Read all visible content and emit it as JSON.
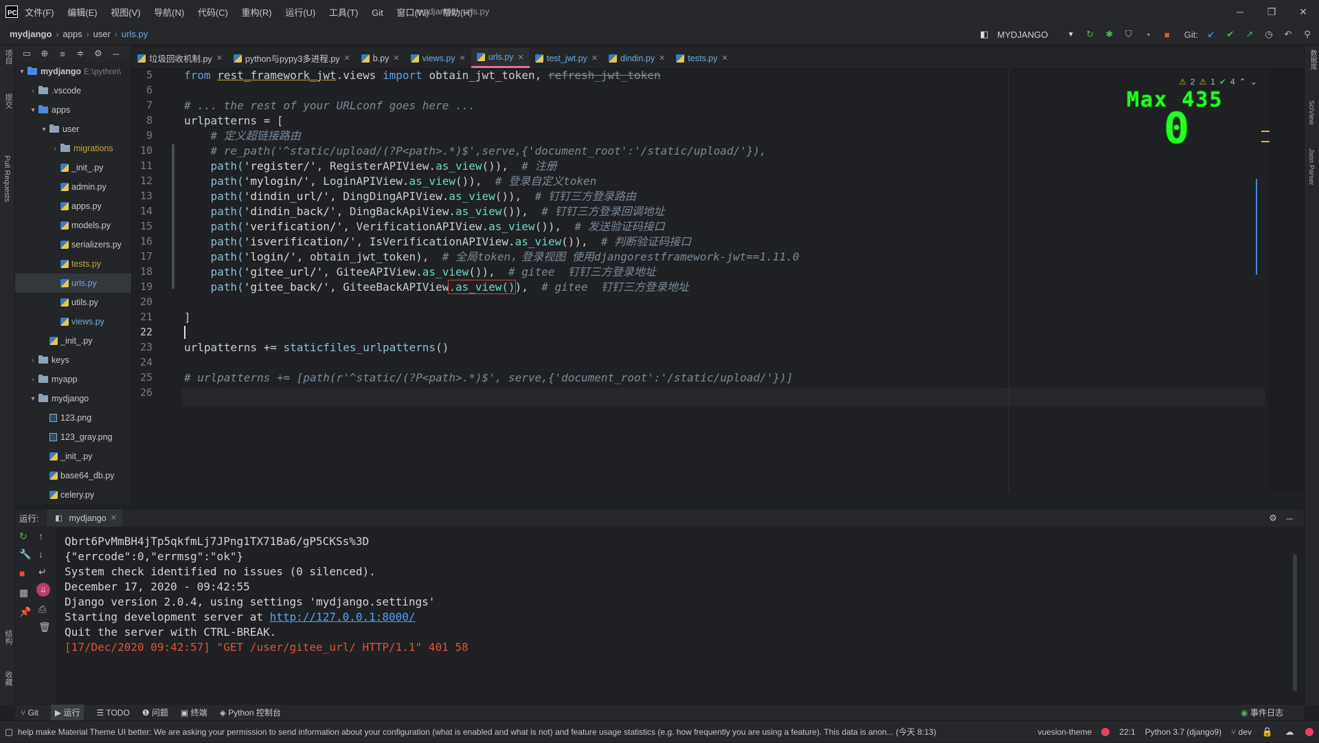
{
  "window": {
    "title": "mydjango - urls.py",
    "menu": [
      "文件(F)",
      "编辑(E)",
      "视图(V)",
      "导航(N)",
      "代码(C)",
      "重构(R)",
      "运行(U)",
      "工具(T)",
      "Git",
      "窗口(W)",
      "帮助(H)"
    ]
  },
  "breadcrumb": {
    "items": [
      "mydjango",
      "apps",
      "user",
      "urls.py"
    ],
    "run_config": "MYDJANGO",
    "git_label": "Git:"
  },
  "project_tree": [
    {
      "label": "mydjango",
      "extra": "E:\\python\\",
      "type": "folder-blue",
      "level": 0,
      "arrow": "▾",
      "bold": true
    },
    {
      "label": ".vscode",
      "type": "folder",
      "level": 1,
      "arrow": "›"
    },
    {
      "label": "apps",
      "type": "folder-blue",
      "level": 1,
      "arrow": "▾"
    },
    {
      "label": "user",
      "type": "folder",
      "level": 2,
      "arrow": "▾"
    },
    {
      "label": "migrations",
      "type": "folder",
      "level": 3,
      "arrow": "›",
      "cls": "mig"
    },
    {
      "label": "_init_.py",
      "type": "py",
      "level": 3
    },
    {
      "label": "admin.py",
      "type": "py",
      "level": 3
    },
    {
      "label": "apps.py",
      "type": "py",
      "level": 3
    },
    {
      "label": "models.py",
      "type": "py",
      "level": 3
    },
    {
      "label": "serializers.py",
      "type": "py",
      "level": 3
    },
    {
      "label": "tests.py",
      "type": "py",
      "level": 3,
      "cls": "yfile"
    },
    {
      "label": "urls.py",
      "type": "py",
      "level": 3,
      "cls": "vfile",
      "selected": true
    },
    {
      "label": "utils.py",
      "type": "py",
      "level": 3
    },
    {
      "label": "views.py",
      "type": "py",
      "level": 3,
      "cls": "vfile"
    },
    {
      "label": "_init_.py",
      "type": "py",
      "level": 2
    },
    {
      "label": "keys",
      "type": "folder",
      "level": 1,
      "arrow": "›"
    },
    {
      "label": "myapp",
      "type": "folder",
      "level": 1,
      "arrow": "›"
    },
    {
      "label": "mydjango",
      "type": "folder",
      "level": 1,
      "arrow": "▾"
    },
    {
      "label": "123.png",
      "type": "img",
      "level": 2
    },
    {
      "label": "123_gray.png",
      "type": "img",
      "level": 2
    },
    {
      "label": "_init_.py",
      "type": "py",
      "level": 2
    },
    {
      "label": "base64_db.py",
      "type": "py",
      "level": 2
    },
    {
      "label": "celery.py",
      "type": "py",
      "level": 2
    }
  ],
  "tabs": [
    {
      "label": "垃圾回收机制.py"
    },
    {
      "label": "python与pypy3多进程.py"
    },
    {
      "label": "b.py"
    },
    {
      "label": "views.py",
      "blue": true
    },
    {
      "label": "urls.py",
      "active": true
    },
    {
      "label": "test_jwt.py",
      "blue": true
    },
    {
      "label": "dindin.py",
      "blue": true
    },
    {
      "label": "tests.py",
      "blue": true
    }
  ],
  "editor": {
    "line_numbers": [
      "5",
      "6",
      "7",
      "8",
      "9",
      "10",
      "11",
      "12",
      "13",
      "14",
      "15",
      "16",
      "17",
      "18",
      "19",
      "20",
      "21",
      "22",
      "23",
      "24",
      "25",
      "26"
    ],
    "current_line": "22",
    "inspections": {
      "warn_a": "2",
      "warn_b": "1",
      "ok": "4"
    },
    "overlay_label": "Max 435",
    "overlay_value": "0",
    "code": {
      "l5_a": "from ",
      "l5_b": "rest_framework_jwt",
      "l5_c": ".views ",
      "l5_d": "import ",
      "l5_e": "obtain_jwt_token, ",
      "l5_f": "refresh_jwt_token",
      "l7": "# ... the rest of your URLconf goes here ...",
      "l8": "urlpatterns = [",
      "l9": "    # 定义超链接路由",
      "l10": "    # re_path('^static/upload/(?P<path>.*)$',serve,{'document_root':'/static/upload/'}),",
      "l11_a": "    path(",
      "l11_b": "'register/'",
      "l11_c": ", RegisterAPIView.",
      "l11_d": "as_view",
      "l11_e": "()),  ",
      "l11_f": "# 注册",
      "l12_b": "'mylogin/'",
      "l12_c": ", LoginAPIView.",
      "l12_f": "# 登录自定义token",
      "l13_b": "'dindin_url/'",
      "l13_c": ", DingDingAPIView.",
      "l13_f": "# 钉钉三方登录路由",
      "l14_b": "'dindin_back/'",
      "l14_c": ", DingBackApiView.",
      "l14_f": "# 钉钉三方登录回调地址",
      "l15_b": "'verification/'",
      "l15_c": ", VerificationAPIView.",
      "l15_f": "# 发送验证码接口",
      "l16_b": "'isverification/'",
      "l16_c": ", IsVerificationAPIView.",
      "l16_f": "# 判断验证码接口",
      "l17_b": "'login/'",
      "l17_c": ", obtain_jwt_token),  ",
      "l17_f": "# 全局token，登录视图 使用djangorestframework-jwt==1.11.0",
      "l18_b": "'gitee_url/'",
      "l18_c": ", GiteeAPIView.",
      "l18_f": "# gitee  钉钉三方登录地址",
      "l19_b": "'gitee_back/'",
      "l19_c": ", GiteeBackAPIView",
      "l19_d": ".as_view()",
      "l19_e": "),  ",
      "l19_f": "# gitee  钉钉三方登录地址",
      "l21": "]",
      "l23_a": "urlpatterns += ",
      "l23_b": "staticfiles_urlpatterns",
      "l23_c": "()",
      "l25": "# urlpatterns += [path(r'^static/(?P<path>.*)$', serve,{'document_root':'/static/upload/'})]"
    }
  },
  "run_panel": {
    "label": "运行:",
    "tab": "mydjango",
    "lines": [
      "Qbrt6PvMmBH4jTp5qkfmLj7JPng1TX71Ba6/gP5CKSs%3D",
      "{\"errcode\":0,\"errmsg\":\"ok\"}",
      "System check identified no issues (0 silenced).",
      "December 17, 2020 - 09:42:55",
      "Django version 2.0.4, using settings 'mydjango.settings'",
      "Starting development server at ",
      "Quit the server with CTRL-BREAK.",
      "[17/Dec/2020 09:42:57] \"GET /user/gitee_url/ HTTP/1.1\" 401 58"
    ],
    "server_link": "http://127.0.0.1:8000/"
  },
  "bottom_tabs": [
    "Git",
    "运行",
    "TODO",
    "问题",
    "终端",
    "Python 控制台"
  ],
  "event_log": "事件日志",
  "status": {
    "message": "help make Material Theme UI better: We are asking your permission to send information about your configuration (what is enabled and what is not) and feature usage statistics (e.g. how frequently you are using a feature). This data is anon... (今天 8:13)",
    "theme": "vuesion-theme",
    "position": "22:1",
    "interpreter": "Python 3.7 (django9)",
    "branch": "dev"
  },
  "left_strip": {
    "project": "项目",
    "commit": "提交",
    "pull_requests": "Pull Requests",
    "structure": "结构",
    "favorites": "收藏"
  },
  "right_strip": {
    "database": "数据库",
    "sciview": "SciView",
    "json_parser": "Json Parser"
  },
  "colors": {
    "accent": "#e36f9c",
    "overlay": "#22ff22",
    "error": "#e0533b",
    "link": "#4ea3ff"
  }
}
